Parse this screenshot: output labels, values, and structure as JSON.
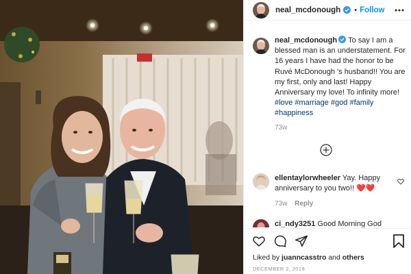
{
  "post": {
    "author": "neal_mcdonough",
    "follow_label": "Follow",
    "separator": "•",
    "photo_alt": "Couple toasting with champagne glasses"
  },
  "caption": {
    "username": "neal_mcdonough",
    "text": "To say I am a blessed man is an understatement. For 16 years I have had the honor to be Ruvé McDonough 's husband!! You are my first, only and last! Happy Anniversary my love! To infinity more! ",
    "hashtags": [
      "#love",
      "#marriage",
      "#god",
      "#family",
      "#happiness"
    ],
    "timestamp": "73w"
  },
  "comments": [
    {
      "username": "ellentaylorwheeler",
      "text": "Yay. Happy anniversary to you two!! ",
      "emoji": "❤️❤️",
      "timestamp": "73w",
      "reply_label": "Reply"
    },
    {
      "username": "ci_ndy3251",
      "text": "Good Morning God"
    }
  ],
  "actions": {
    "liked_by_prefix": "Liked by",
    "liked_by_user": "juanncasstro",
    "liked_by_and": "and",
    "liked_by_others": "others",
    "date": "DECEMBER 2, 2019"
  },
  "colors": {
    "link_blue": "#0095f6",
    "hashtag": "#00376b",
    "meta_gray": "#8e8e8e",
    "text": "#262626",
    "verified": "#3897f0",
    "heart_red": "#ed4956"
  },
  "icons": {
    "verified": "verified-badge-icon",
    "more": "more-options-icon",
    "load_more": "plus-circle-icon",
    "like": "heart-icon",
    "comment": "comment-bubble-icon",
    "share": "paper-plane-icon",
    "save": "bookmark-icon"
  }
}
